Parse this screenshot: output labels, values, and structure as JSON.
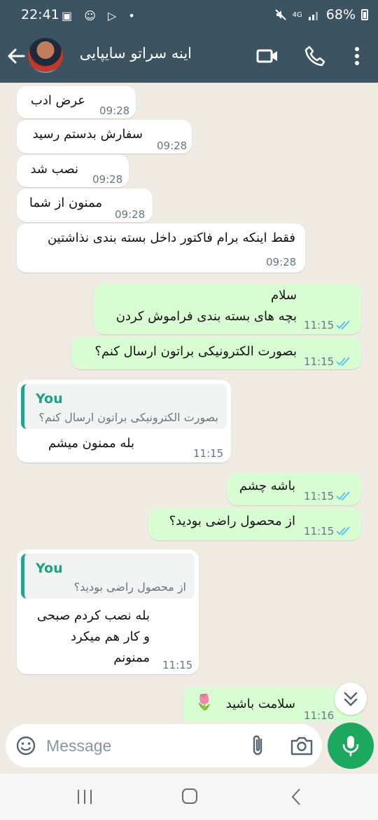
{
  "status_bar": {
    "time": "22:41",
    "left_icons": "▣ ☺ ▷ •",
    "network": "4G",
    "battery": "68%"
  },
  "header": {
    "contact_name": "اینه سراتو سایپایی",
    "icons": [
      "back-arrow-icon",
      "video-call-icon",
      "phone-call-icon",
      "more-vertical-icon"
    ]
  },
  "messages": [
    {
      "dir": "in",
      "text": "عرض ادب",
      "time": "09:28"
    },
    {
      "dir": "in",
      "text": "سفارش بدستم رسید",
      "time": "09:28"
    },
    {
      "dir": "in",
      "text": "نصب شد",
      "time": "09:28"
    },
    {
      "dir": "in",
      "text": "ممنون از شما",
      "time": "09:28"
    },
    {
      "dir": "in",
      "text": "فقط اینکه برام فاکتور داخل بسته بندی نذاشتین",
      "time": "09:28"
    },
    {
      "dir": "out",
      "lines": [
        "سلام",
        "بچه های بسته بندی فراموش کردن"
      ],
      "time": "11:15"
    },
    {
      "dir": "out",
      "text": "بصورت الکترونیکی براتون ارسال کنم؟",
      "time": "11:15"
    },
    {
      "dir": "in",
      "quote_author": "You",
      "quote_text": "بصورت الکترونیکی براتون ارسال کنم؟",
      "text": "بله ممنون میشم",
      "time": "11:15"
    },
    {
      "dir": "out",
      "text": "باشه چشم",
      "time": "11:15"
    },
    {
      "dir": "out",
      "text": "از محصول راضی بودید؟",
      "time": "11:15"
    },
    {
      "dir": "in",
      "quote_author": "You",
      "quote_text": "از محصول راضی بودید؟",
      "lines": [
        "بله نصب کردم صبحی",
        "و کار هم میکرد",
        "ممنونم"
      ],
      "time": "11:15"
    },
    {
      "dir": "out",
      "text": "سلامت باشید",
      "emoji": "🌷",
      "time": "11:16"
    }
  ],
  "input": {
    "placeholder": "Message",
    "icons": [
      "emoji-icon",
      "attach-icon",
      "camera-icon",
      "mic-icon"
    ]
  },
  "colors": {
    "header": "#3c5361",
    "outgoing_bubble": "#d9fdd3",
    "incoming_bubble": "#ffffff",
    "chat_background": "#efeae2",
    "read_tick": "#53bdeb",
    "accent": "#1da85f"
  }
}
